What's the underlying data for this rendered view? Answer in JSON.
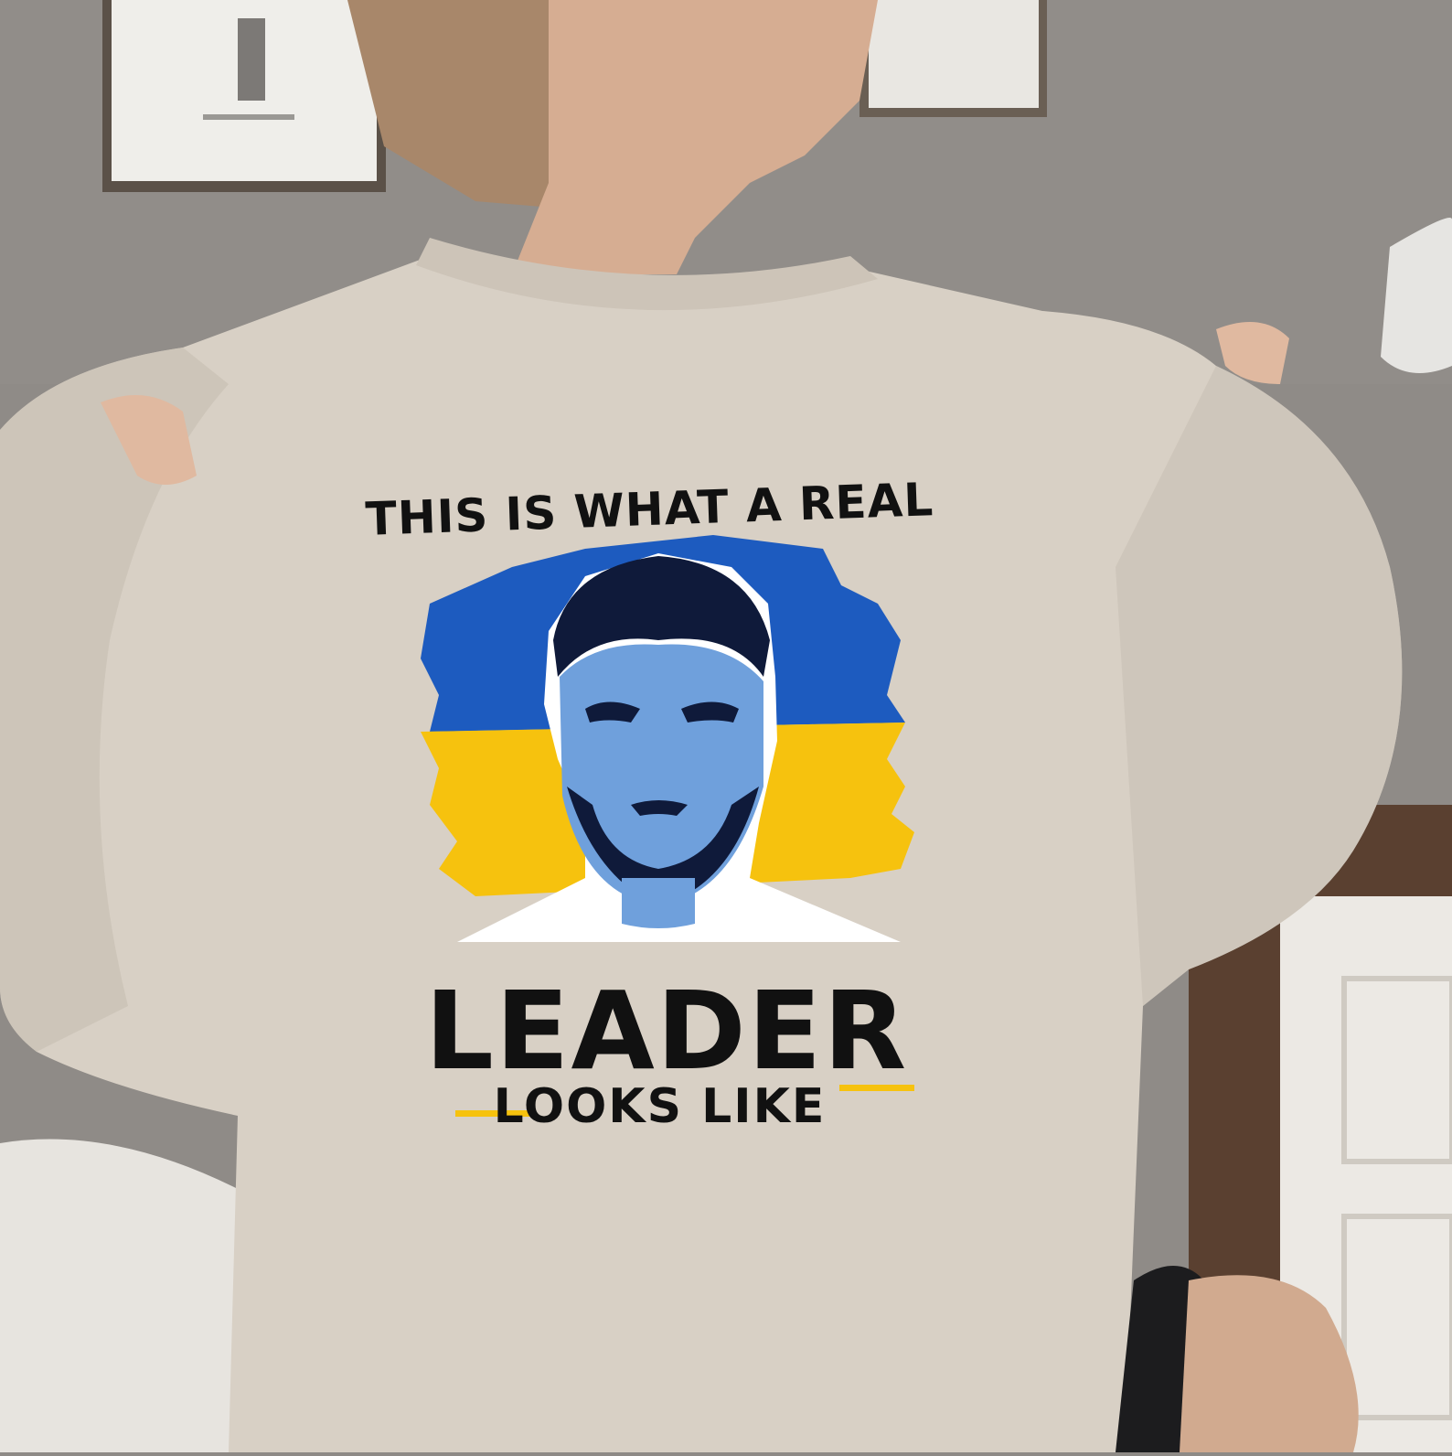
{
  "print": {
    "line_top": "THIS IS WHAT A REAL",
    "line_main": "LEADER",
    "line_bottom": "LOOKS LIKE"
  },
  "colors": {
    "sweater": "#d8d0c5",
    "flag_blue": "#1d5bbf",
    "flag_yellow": "#f6c20e",
    "text": "#111111",
    "wall": "#8e8a86"
  }
}
